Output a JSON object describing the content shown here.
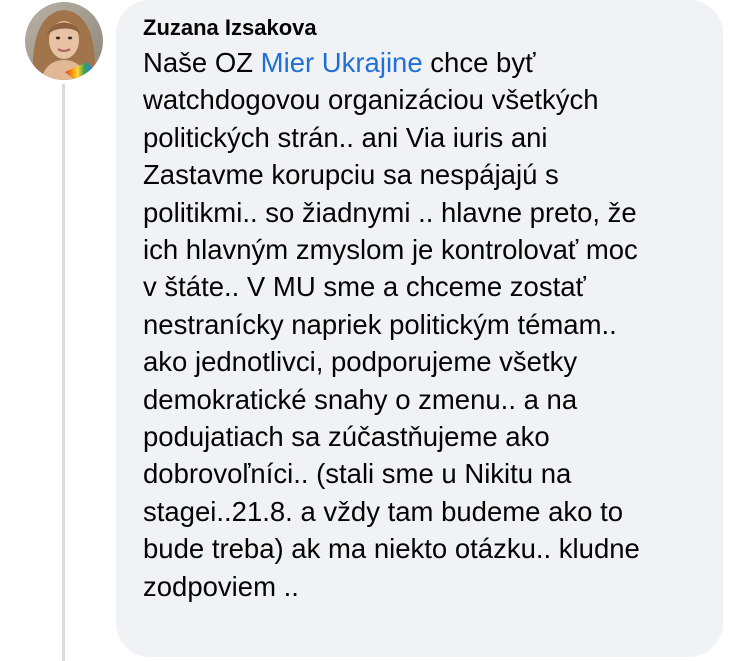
{
  "comment": {
    "author": "Zuzana Izsakova",
    "avatar_icon": "profile-photo",
    "mention": "Mier Ukrajine",
    "lines": [
      {
        "pre": "Naše OZ ",
        "mention": "Mier Ukrajine",
        "post": " chce byť"
      },
      {
        "text": "watchdogovou organizáciou všetkých"
      },
      {
        "text": "politických strán.. ani Via iuris ani"
      },
      {
        "text": "Zastavme korupciu sa nespájajú s"
      },
      {
        "text": "politikmi.. so žiadnymi .. hlavne preto, že"
      },
      {
        "text": "ich hlavným zmyslom je kontrolovať moc"
      },
      {
        "text": "v štáte.. V MU sme a chceme zostať"
      },
      {
        "text": "nestranícky napriek politickým témam.."
      },
      {
        "text": "ako jednotlivci, podporujeme všetky"
      },
      {
        "text": "demokratické snahy o zmenu.. a na"
      },
      {
        "text": "podujatiach sa zúčastňujeme ako"
      },
      {
        "text": "dobrovoľníci.. (stali sme u Nikitu na"
      },
      {
        "text": "stagei..21.8. a vždy tam budeme ako to"
      },
      {
        "text": "bude treba) ak ma niekto otázku.. kludne"
      },
      {
        "text": "zodpoviem .."
      }
    ]
  },
  "colors": {
    "bubble_bg": "#f0f2f5",
    "text": "#050505",
    "mention": "#1f6fd6",
    "thread_line": "#d9dadd"
  }
}
